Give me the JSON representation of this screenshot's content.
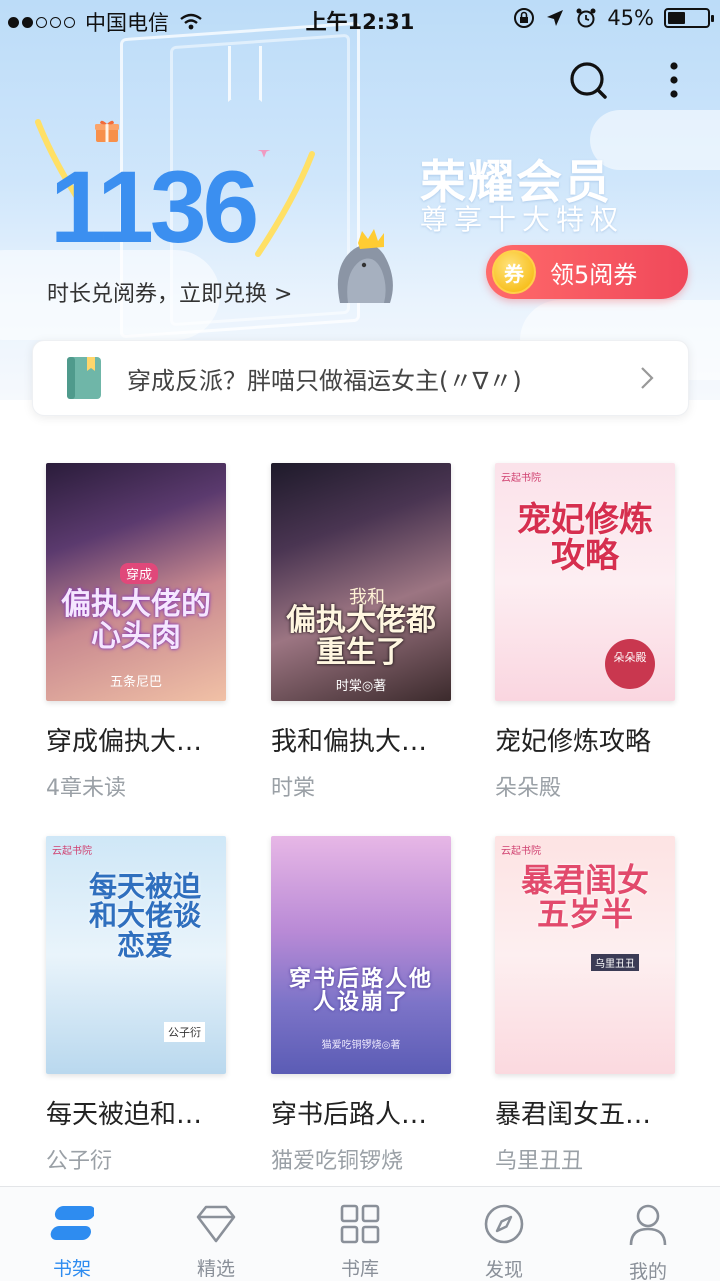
{
  "status_bar": {
    "carrier": "中国电信",
    "time": "上午12:31",
    "battery_percent": "45%",
    "battery_level": 0.45
  },
  "hero": {
    "minutes": "1136",
    "exchange_text": "时长兑阅券，立即兑换 >",
    "vip_title": "荣耀会员",
    "vip_subtitle": "尊享十大特权",
    "coupon_coin_text": "券",
    "coupon_label": "领5阅券"
  },
  "notice": {
    "text": "穿成反派？胖喵只做福运女主(〃∇〃)"
  },
  "books": [
    {
      "title": "穿成偏执大…",
      "subtitle": "4章未读",
      "cover_title": "偏执大佬的心头肉",
      "cover_tag": "穿成",
      "cover_author": "五条尼巴"
    },
    {
      "title": "我和偏执大…",
      "subtitle": "时棠",
      "cover_title": "偏执大佬都重生了",
      "cover_tag": "我和",
      "cover_author": "时棠◎著"
    },
    {
      "title": "宠妃修炼攻略",
      "subtitle": "朵朵殿",
      "cover_title": "宠妃修炼攻略",
      "cover_tag": "云起书院",
      "cover_author": "朵朵殿"
    },
    {
      "title": "每天被迫和…",
      "subtitle": "公子衍",
      "cover_title": "每天被迫和大佬谈恋爱",
      "cover_tag": "云起书院",
      "cover_author": "公子衍"
    },
    {
      "title": "穿书后路人…",
      "subtitle": "猫爱吃铜锣烧",
      "cover_title": "穿书后路人他人设崩了",
      "cover_tag": "",
      "cover_author": "猫爱吃铜锣烧◎著"
    },
    {
      "title": "暴君闺女五…",
      "subtitle": "乌里丑丑",
      "cover_title": "暴君闺女五岁半",
      "cover_tag": "云起书院",
      "cover_author": "乌里丑丑"
    }
  ],
  "tabs": [
    {
      "label": "书架",
      "icon": "bookshelf-icon",
      "active": true
    },
    {
      "label": "精选",
      "icon": "diamond-icon",
      "active": false
    },
    {
      "label": "书库",
      "icon": "grid-icon",
      "active": false
    },
    {
      "label": "发现",
      "icon": "compass-icon",
      "active": false
    },
    {
      "label": "我的",
      "icon": "person-icon",
      "active": false
    }
  ],
  "colors": {
    "accent": "#2e8cf0",
    "minutes": "#3b8ff0",
    "coupon": "#f0485a"
  }
}
